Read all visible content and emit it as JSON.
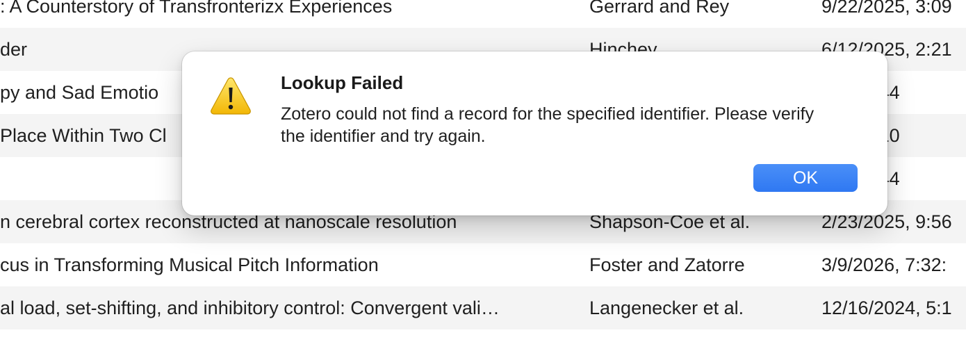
{
  "items_table": {
    "rows": [
      {
        "title": ": A Counterstory of Transfronterizx Experiences",
        "creator": "Gerrard and Rey",
        "date_added": "9/22/2025, 3:09"
      },
      {
        "title": "der",
        "creator": "Hinchey",
        "date_added": "6/12/2025, 2:21"
      },
      {
        "title": "py and Sad Emotio",
        "creator": "",
        "date_added": "025, 2:44"
      },
      {
        "title": "Place Within Two Cl",
        "creator": "",
        "date_added": "025, 3:10"
      },
      {
        "title": "",
        "creator": "",
        "date_added": "025, 2:44"
      },
      {
        "title": "n cerebral cortex reconstructed at nanoscale resolution",
        "creator": "Shapson-Coe et al.",
        "date_added": "2/23/2025, 9:56"
      },
      {
        "title": "cus in Transforming Musical Pitch Information",
        "creator": "Foster and Zatorre",
        "date_added": "3/9/2026, 7:32:"
      },
      {
        "title": "al load, set-shifting, and inhibitory control: Convergent vali…",
        "creator": "Langenecker et al.",
        "date_added": "12/16/2024, 5:1"
      }
    ]
  },
  "dialog": {
    "icon": "warning-icon",
    "title": "Lookup Failed",
    "message": "Zotero could not find a record for the specified identifier. Please verify the identifier and try again.",
    "ok_label": "OK"
  },
  "colors": {
    "accent": "#3b82f6",
    "warning_yellow": "#f5c518",
    "row_alt": "#f4f4f4"
  }
}
